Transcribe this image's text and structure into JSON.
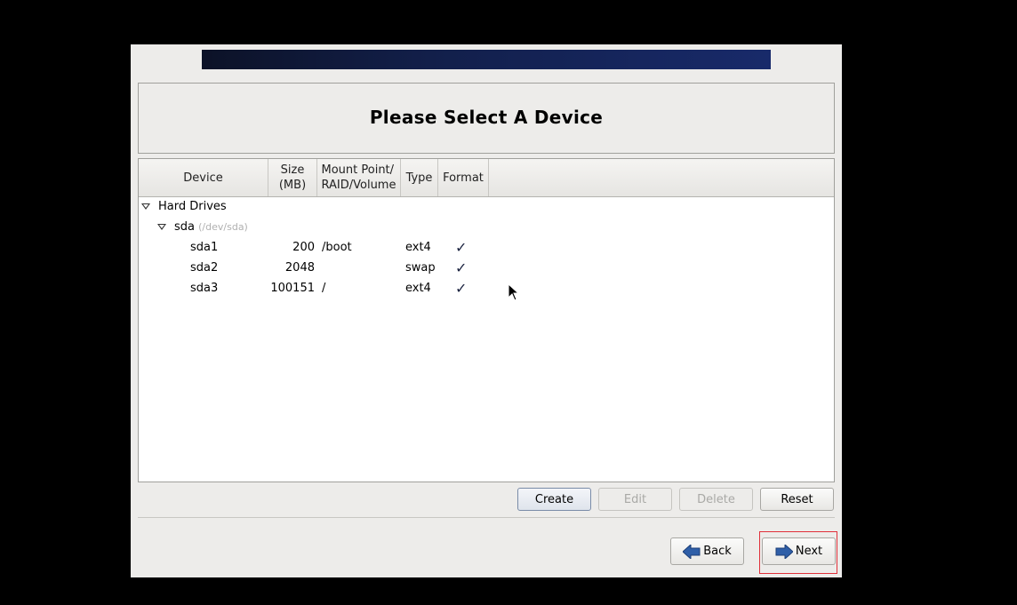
{
  "header": {
    "title": "Please Select A Device"
  },
  "table": {
    "columns": [
      {
        "label": "Device"
      },
      {
        "label_line1": "Size",
        "label_line2": "(MB)"
      },
      {
        "label_line1": "Mount Point/",
        "label_line2": "RAID/Volume"
      },
      {
        "label": "Type"
      },
      {
        "label": "Format"
      }
    ],
    "groups": {
      "hard_drives": {
        "label": "Hard Drives",
        "expanded": true
      },
      "sda": {
        "label": "sda",
        "path": "(/dev/sda)",
        "expanded": true
      }
    },
    "rows": [
      {
        "device": "sda1",
        "size": "200",
        "mount": "/boot",
        "type": "ext4",
        "format": "✓"
      },
      {
        "device": "sda2",
        "size": "2048",
        "mount": "",
        "type": "swap",
        "format": "✓"
      },
      {
        "device": "sda3",
        "size": "100151",
        "mount": "/",
        "type": "ext4",
        "format": "✓"
      }
    ]
  },
  "actions": {
    "create": "Create",
    "edit": "Edit",
    "delete": "Delete",
    "reset": "Reset"
  },
  "nav": {
    "back": "Back",
    "next": "Next"
  },
  "colors": {
    "banner_start": "#0c1227",
    "banner_end": "#182a6a",
    "arrow_blue": "#2f5fa8",
    "highlight_red": "#e0303a"
  }
}
